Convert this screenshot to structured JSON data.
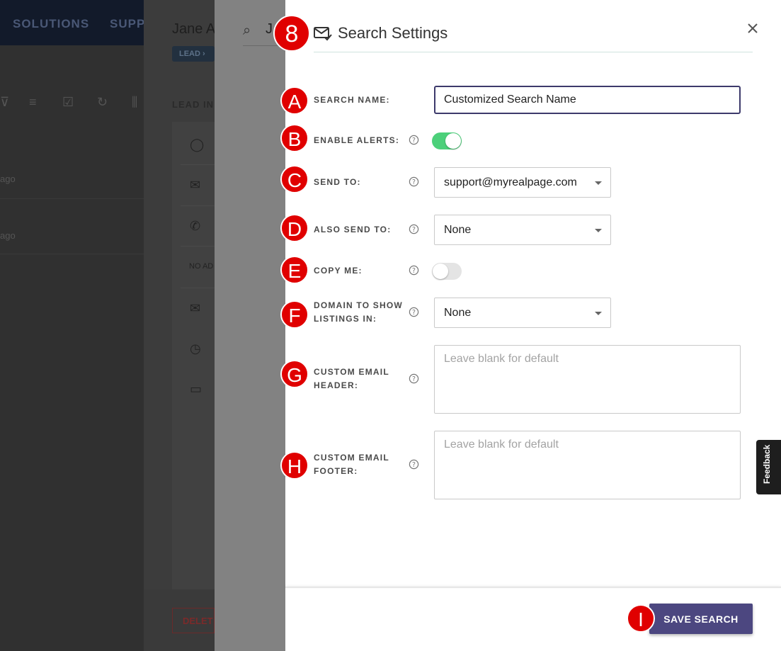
{
  "background": {
    "nav_items": [
      "SOLUTIONS",
      "SUPP"
    ],
    "ago_1": "ago",
    "ago_2": "ago",
    "lead_name": "Jane A",
    "lead_badge": "LEAD",
    "lead_section": "LEAD IN",
    "no_address": "NO AD",
    "delete_label": "DELET",
    "panel_title_fragment": "J"
  },
  "dialog": {
    "title": "Search Settings",
    "header_icon": "mail-check-icon",
    "close_icon": "close-icon",
    "fields": {
      "search_name": {
        "label": "SEARCH NAME:",
        "value": "Customized Search Name"
      },
      "enable_alerts": {
        "label": "ENABLE ALERTS:",
        "enabled": true
      },
      "send_to": {
        "label": "SEND TO:",
        "value": "support@myrealpage.com"
      },
      "also_send_to": {
        "label": "ALSO SEND TO:",
        "value": "None"
      },
      "copy_me": {
        "label": "COPY ME:",
        "enabled": false
      },
      "domain": {
        "label_line1": "DOMAIN TO SHOW",
        "label_line2": "LISTINGS IN:",
        "value": "None"
      },
      "email_header": {
        "label_line1": "CUSTOM EMAIL",
        "label_line2": "HEADER:",
        "placeholder": "Leave blank for default"
      },
      "email_footer": {
        "label_line1": "CUSTOM EMAIL",
        "label_line2": "FOOTER:",
        "placeholder": "Leave blank for default"
      }
    },
    "save_label": "SAVE SEARCH"
  },
  "markers": [
    "8",
    "A",
    "B",
    "C",
    "D",
    "E",
    "F",
    "G",
    "H",
    "I"
  ],
  "feedback_label": "Feedback",
  "colors": {
    "accent": "#4c4780",
    "toggle_on": "#4cd07a",
    "marker": "#e00000"
  }
}
